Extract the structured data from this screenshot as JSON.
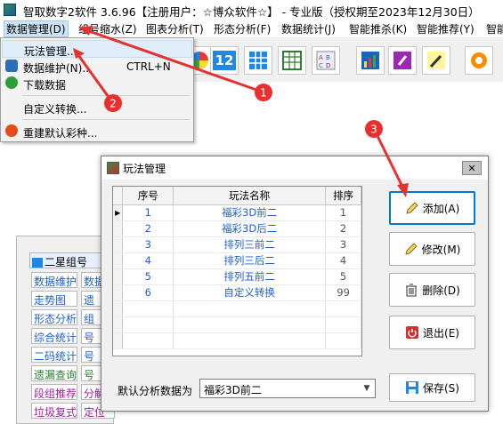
{
  "app": {
    "title": "智取数字2软件 3.6.96【注册用户：☆博众软件☆】 - 专业版（授权期至2023年12月30日）"
  },
  "menubar": {
    "items": [
      {
        "label": "数据管理(D)"
      },
      {
        "label": "组号缩水(Z)"
      },
      {
        "label": "图表分析(T)"
      },
      {
        "label": "形态分析(F)"
      },
      {
        "label": "数据统计(J)"
      },
      {
        "label": "智能推杀(K)"
      },
      {
        "label": "智能推荐(Y)"
      },
      {
        "label": "智能"
      }
    ]
  },
  "toolbar": {
    "number_icon_text": "12"
  },
  "dropdown": {
    "items": [
      {
        "label": "玩法管理...",
        "shortcut": ""
      },
      {
        "label": "数据维护(N)...",
        "shortcut": "CTRL+N"
      },
      {
        "label": "下载数据",
        "shortcut": ""
      },
      {
        "label": "自定义转换...",
        "shortcut": ""
      },
      {
        "label": "重建默认彩种...",
        "shortcut": ""
      }
    ]
  },
  "left_panel": {
    "header": "二星组号",
    "buttons": [
      [
        "数据维护",
        "数据"
      ],
      [
        "走势图",
        "遗"
      ],
      [
        "形态分析",
        "组"
      ],
      [
        "综合统计",
        "号"
      ],
      [
        "二码统计",
        "号"
      ],
      [
        "遗漏查询",
        "号"
      ],
      [
        "段组推荐",
        "分解"
      ],
      [
        "垃圾复式",
        "定位"
      ]
    ]
  },
  "dialog": {
    "title": "玩法管理",
    "close_glyph": "✕",
    "table": {
      "columns": [
        "序号",
        "玩法名称",
        "排序"
      ],
      "rows": [
        {
          "id": "1",
          "name": "福彩3D前二",
          "order": "1"
        },
        {
          "id": "2",
          "name": "福彩3D后二",
          "order": "2"
        },
        {
          "id": "3",
          "name": "排列三前二",
          "order": "3"
        },
        {
          "id": "4",
          "name": "排列三后二",
          "order": "4"
        },
        {
          "id": "5",
          "name": "排列五前二",
          "order": "5"
        },
        {
          "id": "6",
          "name": "自定义转换",
          "order": "99"
        }
      ]
    },
    "buttons": {
      "add": "添加(A)",
      "edit": "修改(M)",
      "delete": "删除(D)",
      "exit": "退出(E)",
      "save": "保存(S)"
    },
    "default_label": "默认分析数据为",
    "default_value": "福彩3D前二"
  },
  "annotations": [
    "1",
    "2",
    "3"
  ],
  "colors": {
    "annotation_red": "#e8312f",
    "link_blue": "#1f5fcf",
    "focus_blue": "#0078d7"
  }
}
